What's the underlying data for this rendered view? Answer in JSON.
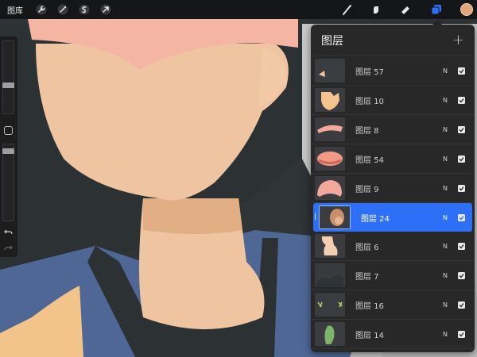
{
  "toolbar": {
    "gallery_label": "图库",
    "left_icons": [
      "wrench-icon",
      "magic-wand-icon",
      "selection-icon",
      "transform-arrow-icon"
    ],
    "right_icons": [
      "brush-icon",
      "smudge-icon",
      "eraser-icon",
      "layers-icon"
    ],
    "active_tool": "layers",
    "current_color": "#e3a577"
  },
  "layers_panel": {
    "title": "图层",
    "add_label": "+",
    "layers": [
      {
        "name": "图层 57",
        "blend": "N",
        "visible": true,
        "selected": false
      },
      {
        "name": "图层 10",
        "blend": "N",
        "visible": true,
        "selected": false
      },
      {
        "name": "图层 8",
        "blend": "N",
        "visible": true,
        "selected": false
      },
      {
        "name": "图层 54",
        "blend": "N",
        "visible": true,
        "selected": false
      },
      {
        "name": "图层 9",
        "blend": "N",
        "visible": true,
        "selected": false
      },
      {
        "name": "图层 24",
        "blend": "N",
        "visible": true,
        "selected": true
      },
      {
        "name": "图层 6",
        "blend": "N",
        "visible": true,
        "selected": false
      },
      {
        "name": "图层 7",
        "blend": "N",
        "visible": true,
        "selected": false
      },
      {
        "name": "图层 16",
        "blend": "N",
        "visible": true,
        "selected": false
      },
      {
        "name": "图层 14",
        "blend": "N",
        "visible": true,
        "selected": false
      }
    ]
  },
  "colors": {
    "accent": "#2d6ff7",
    "skin": "#eec5a0",
    "hair": "#2c3134",
    "shirt": "#4e6795",
    "hat": "#f4b5a3"
  }
}
